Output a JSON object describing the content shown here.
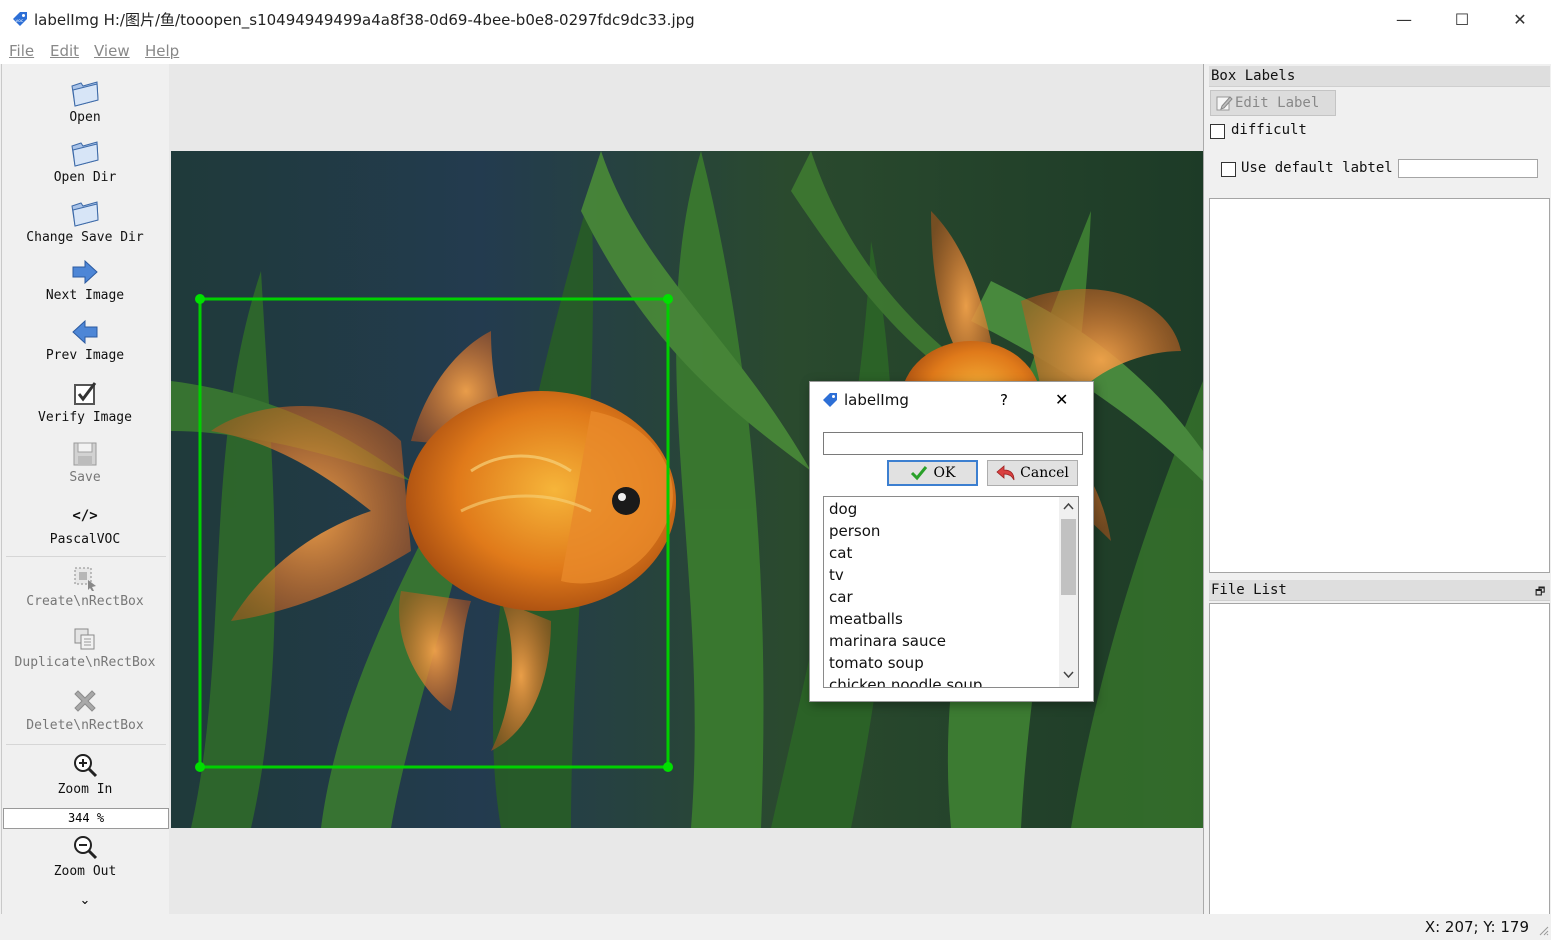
{
  "window": {
    "title": "labelImg H:/图片/鱼/tooopen_s10494949499a4a8f38-0d69-4bee-b0e8-0297fdc9dc33.jpg",
    "minimize_glyph": "—",
    "maximize_glyph": "☐",
    "close_glyph": "✕"
  },
  "menu": {
    "file": "File",
    "edit": "Edit",
    "view": "View",
    "help": "Help"
  },
  "toolbar": {
    "open": "Open",
    "open_dir": "Open Dir",
    "change_save_dir": "Change Save Dir",
    "next_image": "Next Image",
    "prev_image": "Prev Image",
    "verify_image": "Verify Image",
    "save": "Save",
    "format_glyph": "</>",
    "format": "PascalVOC",
    "create_rectbox": "Create\\nRectBox",
    "duplicate_rectbox": "Duplicate\\nRectBox",
    "delete_rectbox": "Delete\\nRectBox",
    "zoom_in": "Zoom In",
    "zoom_value": "344 %",
    "zoom_out": "Zoom Out",
    "more_glyph": "⌄"
  },
  "dialog": {
    "title": "labelImg",
    "help_glyph": "?",
    "close_glyph": "✕",
    "input_value": "",
    "ok_label": "OK",
    "cancel_label": "Cancel",
    "labels": [
      "dog",
      "person",
      "cat",
      "tv",
      "car",
      "meatballs",
      "marinara sauce",
      "tomato soup",
      "chicken noodle soup"
    ]
  },
  "box_labels_panel": {
    "title": "Box Labels",
    "edit_label_button": "Edit Label",
    "difficult_label": "difficult",
    "difficult_checked": false,
    "use_default_label": "Use default labtel",
    "use_default_checked": false,
    "default_label_value": ""
  },
  "file_list_panel": {
    "title": "File List",
    "float_glyph": "🗗"
  },
  "status_bar": {
    "coords": "X: 207; Y: 179"
  },
  "colors": {
    "bounding_box": "#00d000",
    "ok_border": "#3c7fd0"
  }
}
